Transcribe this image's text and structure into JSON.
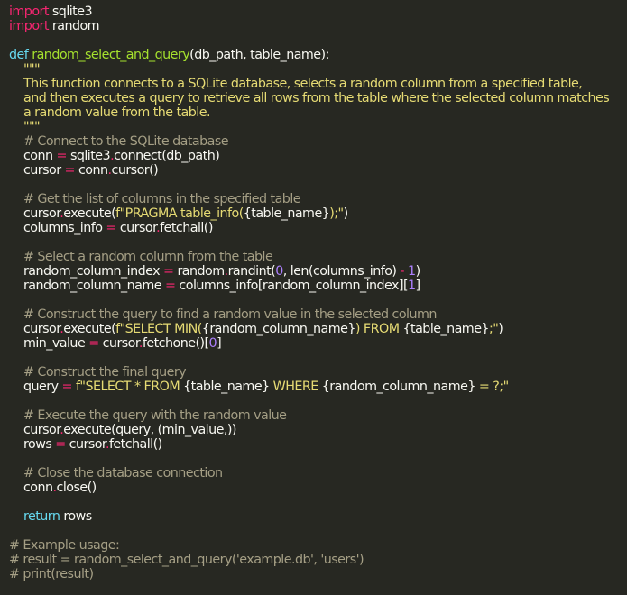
{
  "colors": {
    "background": "#272822",
    "text": "#f8f8f2",
    "keyword_pink": "#f92672",
    "keyword_blue": "#66d9ef",
    "function_green": "#a6e22e",
    "string_yellow": "#e6db74",
    "number_purple": "#ae81ff",
    "comment_grey": "#a59f85"
  },
  "lines": [
    [
      [
        "kw",
        "import"
      ],
      [
        "plain",
        " sqlite3"
      ]
    ],
    [
      [
        "kw",
        "import"
      ],
      [
        "plain",
        " random"
      ]
    ],
    [],
    [
      [
        "def",
        "def"
      ],
      [
        "plain",
        " "
      ],
      [
        "fn",
        "random_select_and_query"
      ],
      [
        "plain",
        "(db_path, table_name):"
      ]
    ],
    [
      [
        "str",
        "    \"\"\""
      ]
    ],
    [
      [
        "str",
        "    This function connects to a SQLite database, selects a random column from a specified table,"
      ]
    ],
    [
      [
        "str",
        "    and then executes a query to retrieve all rows from the table where the selected column matches"
      ]
    ],
    [
      [
        "str",
        "    a random value from the table."
      ]
    ],
    [
      [
        "str",
        "    \"\"\""
      ]
    ],
    [
      [
        "cmt",
        "    # Connect to the SQLite database"
      ]
    ],
    [
      [
        "plain",
        "    conn "
      ],
      [
        "op",
        "="
      ],
      [
        "plain",
        " sqlite3"
      ],
      [
        "op",
        "."
      ],
      [
        "plain",
        "connect(db_path)"
      ]
    ],
    [
      [
        "plain",
        "    cursor "
      ],
      [
        "op",
        "="
      ],
      [
        "plain",
        " conn"
      ],
      [
        "op",
        "."
      ],
      [
        "plain",
        "cursor()"
      ]
    ],
    [],
    [
      [
        "cmt",
        "    # Get the list of columns in the specified table"
      ]
    ],
    [
      [
        "plain",
        "    cursor"
      ],
      [
        "op",
        "."
      ],
      [
        "plain",
        "execute("
      ],
      [
        "str",
        "f\"PRAGMA table_info("
      ],
      [
        "plain",
        "{table_name}"
      ],
      [
        "str",
        ");\""
      ],
      [
        "plain",
        ")"
      ]
    ],
    [
      [
        "plain",
        "    columns_info "
      ],
      [
        "op",
        "="
      ],
      [
        "plain",
        " cursor"
      ],
      [
        "op",
        "."
      ],
      [
        "plain",
        "fetchall()"
      ]
    ],
    [],
    [
      [
        "cmt",
        "    # Select a random column from the table"
      ]
    ],
    [
      [
        "plain",
        "    random_column_index "
      ],
      [
        "op",
        "="
      ],
      [
        "plain",
        " random"
      ],
      [
        "op",
        "."
      ],
      [
        "plain",
        "randint("
      ],
      [
        "num",
        "0"
      ],
      [
        "plain",
        ", len(columns_info) "
      ],
      [
        "op",
        "-"
      ],
      [
        "plain",
        " "
      ],
      [
        "num",
        "1"
      ],
      [
        "plain",
        ")"
      ]
    ],
    [
      [
        "plain",
        "    random_column_name "
      ],
      [
        "op",
        "="
      ],
      [
        "plain",
        " columns_info[random_column_index]["
      ],
      [
        "num",
        "1"
      ],
      [
        "plain",
        "]"
      ]
    ],
    [],
    [
      [
        "cmt",
        "    # Construct the query to find a random value in the selected column"
      ]
    ],
    [
      [
        "plain",
        "    cursor"
      ],
      [
        "op",
        "."
      ],
      [
        "plain",
        "execute("
      ],
      [
        "str",
        "f\"SELECT MIN("
      ],
      [
        "plain",
        "{random_column_name}"
      ],
      [
        "str",
        ") FROM "
      ],
      [
        "plain",
        "{table_name}"
      ],
      [
        "str",
        ";\""
      ],
      [
        "plain",
        ")"
      ]
    ],
    [
      [
        "plain",
        "    min_value "
      ],
      [
        "op",
        "="
      ],
      [
        "plain",
        " cursor"
      ],
      [
        "op",
        "."
      ],
      [
        "plain",
        "fetchone()["
      ],
      [
        "num",
        "0"
      ],
      [
        "plain",
        "]"
      ]
    ],
    [],
    [
      [
        "cmt",
        "    # Construct the final query"
      ]
    ],
    [
      [
        "plain",
        "    query "
      ],
      [
        "op",
        "="
      ],
      [
        "plain",
        " "
      ],
      [
        "str",
        "f\"SELECT * FROM "
      ],
      [
        "plain",
        "{table_name}"
      ],
      [
        "str",
        " WHERE "
      ],
      [
        "plain",
        "{random_column_name}"
      ],
      [
        "str",
        " = ?;\""
      ]
    ],
    [],
    [
      [
        "cmt",
        "    # Execute the query with the random value"
      ]
    ],
    [
      [
        "plain",
        "    cursor"
      ],
      [
        "op",
        "."
      ],
      [
        "plain",
        "execute(query, (min_value,))"
      ]
    ],
    [
      [
        "plain",
        "    rows "
      ],
      [
        "op",
        "="
      ],
      [
        "plain",
        " cursor"
      ],
      [
        "op",
        "."
      ],
      [
        "plain",
        "fetchall()"
      ]
    ],
    [],
    [
      [
        "cmt",
        "    # Close the database connection"
      ]
    ],
    [
      [
        "plain",
        "    conn"
      ],
      [
        "op",
        "."
      ],
      [
        "plain",
        "close()"
      ]
    ],
    [],
    [
      [
        "plain",
        "    "
      ],
      [
        "def",
        "return"
      ],
      [
        "plain",
        " rows"
      ]
    ],
    [],
    [
      [
        "cmt",
        "# Example usage:"
      ]
    ],
    [
      [
        "cmt",
        "# result = random_select_and_query('example.db', 'users')"
      ]
    ],
    [
      [
        "cmt",
        "# print(result)"
      ]
    ]
  ]
}
